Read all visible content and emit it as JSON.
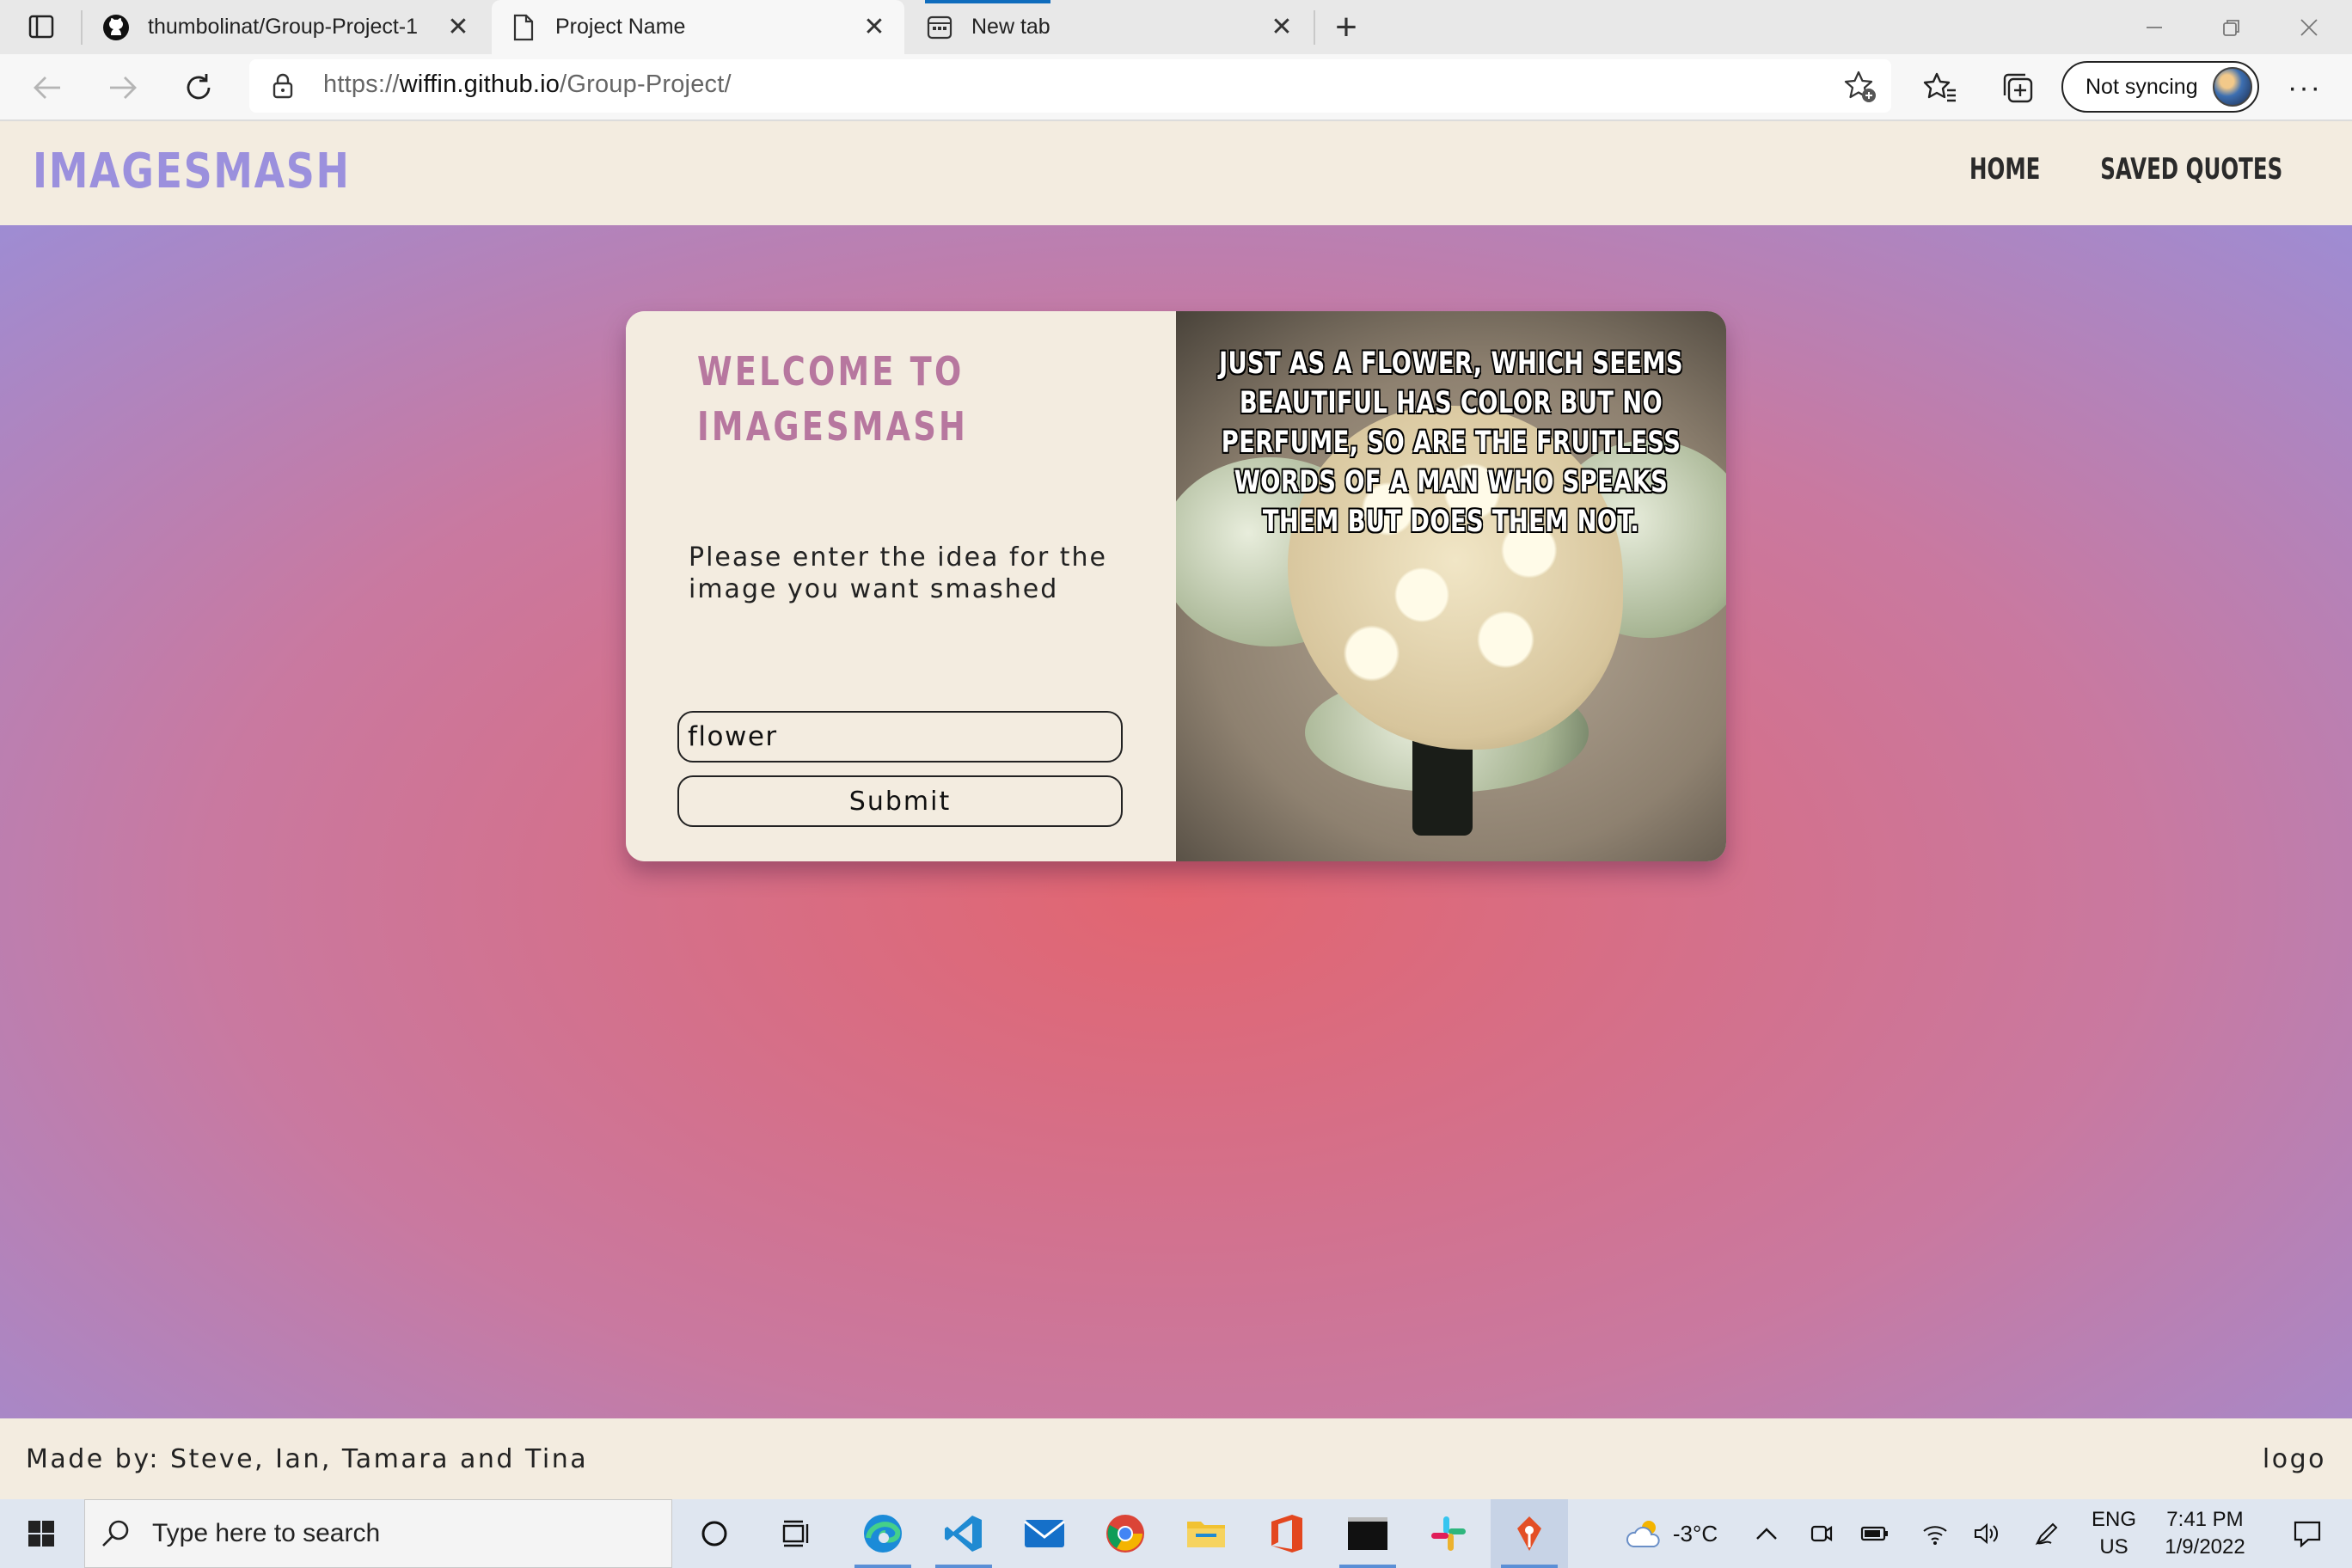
{
  "browser": {
    "tabs": [
      {
        "label": "thumbolinat/Group-Project-1",
        "icon": "github-icon",
        "active": false
      },
      {
        "label": "Project Name",
        "icon": "page-icon",
        "active": true
      },
      {
        "label": "New tab",
        "icon": "newtab-icon",
        "active": false
      }
    ],
    "close_glyph": "✕",
    "new_tab_glyph": "+",
    "url": {
      "prefix": "https://",
      "host": "wiffin.github.io",
      "path": "/Group-Project/"
    },
    "profile_label": "Not syncing",
    "more_glyph": "···"
  },
  "site": {
    "brand": "IMAGESMASH",
    "nav": [
      "HOME",
      "SAVED QUOTES"
    ],
    "welcome_line1": "WELCOME TO",
    "welcome_line2": "IMAGESMASH",
    "prompt": "Please enter the idea for the image you want smashed",
    "input_value": "flower",
    "submit_label": "Submit",
    "quote": "JUST AS A FLOWER, WHICH SEEMS BEAUTIFUL HAS COLOR BUT NO PERFUME, SO ARE THE FRUITLESS WORDS OF A MAN WHO SPEAKS THEM BUT DOES THEM NOT.",
    "footer_credits": "Made by: Steve, Ian, Tamara and Tina",
    "footer_logo": "logo",
    "colors": {
      "brand": "#9b90dd",
      "welcome": "#b7779f",
      "panel": "#f3ece0",
      "gradient_center": "#e26570",
      "gradient_edge": "#9a8ed8"
    }
  },
  "taskbar": {
    "search_placeholder": "Type here to search",
    "weather": "-3°C",
    "lang_line1": "ENG",
    "lang_line2": "US",
    "time": "7:41 PM",
    "date": "1/9/2022",
    "apps": [
      "cortana-icon",
      "task-view-icon",
      "edge-icon",
      "vscode-icon",
      "mail-icon",
      "chrome-icon",
      "file-explorer-icon",
      "office-icon",
      "terminal-icon",
      "slack-icon",
      "git-icon"
    ]
  }
}
